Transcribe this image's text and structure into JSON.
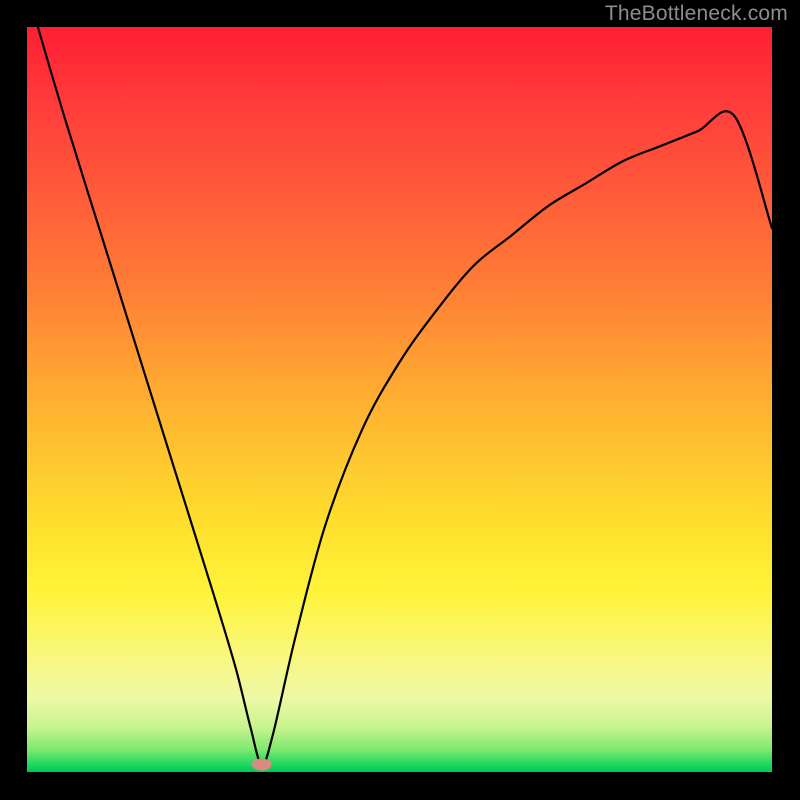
{
  "watermark": "TheBottleneck.com",
  "chart_data": {
    "type": "line",
    "title": "",
    "xlabel": "",
    "ylabel": "",
    "xlim": [
      0,
      100
    ],
    "ylim": [
      0,
      100
    ],
    "grid": false,
    "background_gradient": {
      "top_color": "#ff1f33",
      "mid_color": "#ffe22e",
      "bottom_color": "#00c853"
    },
    "series": [
      {
        "name": "bottleneck-curve",
        "x": [
          0,
          5,
          10,
          15,
          20,
          25,
          28,
          30,
          31.5,
          33,
          36,
          40,
          45,
          50,
          55,
          60,
          65,
          70,
          75,
          80,
          85,
          90,
          95,
          100
        ],
        "y": [
          105,
          88,
          72,
          56,
          40,
          24,
          14,
          6,
          1,
          5,
          18,
          33,
          46,
          55,
          62,
          68,
          72,
          76,
          79,
          82,
          84,
          86,
          88,
          73
        ]
      }
    ],
    "annotations": [
      {
        "name": "min-marker",
        "shape": "ellipse",
        "x": 31.5,
        "y": 1,
        "color": "#d98a83"
      }
    ]
  }
}
